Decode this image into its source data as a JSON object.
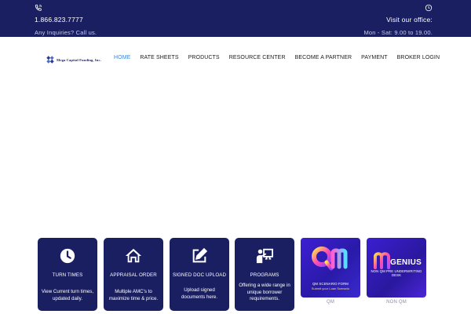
{
  "topbar": {
    "phone": "1.866.823.7777",
    "phone_note": "Any Inquiries? Call us.",
    "office_label": "Visit our office:",
    "hours": "Mon - Sat: 9.00 to 19.00.",
    "phone_icon": "phone-icon",
    "clock_icon": "clock-icon"
  },
  "header": {
    "logo_text": "Mega Capital Funding, Inc.",
    "nav": [
      {
        "label": "HOME",
        "active": true
      },
      {
        "label": "RATE SHEETS"
      },
      {
        "label": "PRODUCTS"
      },
      {
        "label": "RESOURCE CENTER"
      },
      {
        "label": "BECOME A PARTNER"
      },
      {
        "label": "PAYMENT"
      },
      {
        "label": "BROKER LOGIN"
      }
    ]
  },
  "cards": [
    {
      "title": "TURN TIMES",
      "desc": "View Current turn times, updated daily.",
      "icon": "clock-icon"
    },
    {
      "title": "APPRAISAL ORDER",
      "desc": "Multiple AMC's to maximize time & price.",
      "icon": "home-icon"
    },
    {
      "title": "SIGNED DOC UPLOAD",
      "desc": "Upload signed documents here.",
      "icon": "edit-icon"
    },
    {
      "title": "PROGRAMS",
      "desc": "Offering a wide range in unique borrower requirements.",
      "icon": "presentation-icon"
    }
  ],
  "promos": [
    {
      "label": "QM SCENARIO FORM",
      "sublabel": "Submit your Loan Scenario",
      "caption": "QM"
    },
    {
      "word": "GENIUS",
      "label": "NON QM PRE UNDERWRITING DESK",
      "caption": "NON QM"
    }
  ],
  "colors": {
    "navy": "#1a1f61",
    "nav_active": "#3f86d4",
    "promo_purple": "#3d1fd4"
  }
}
